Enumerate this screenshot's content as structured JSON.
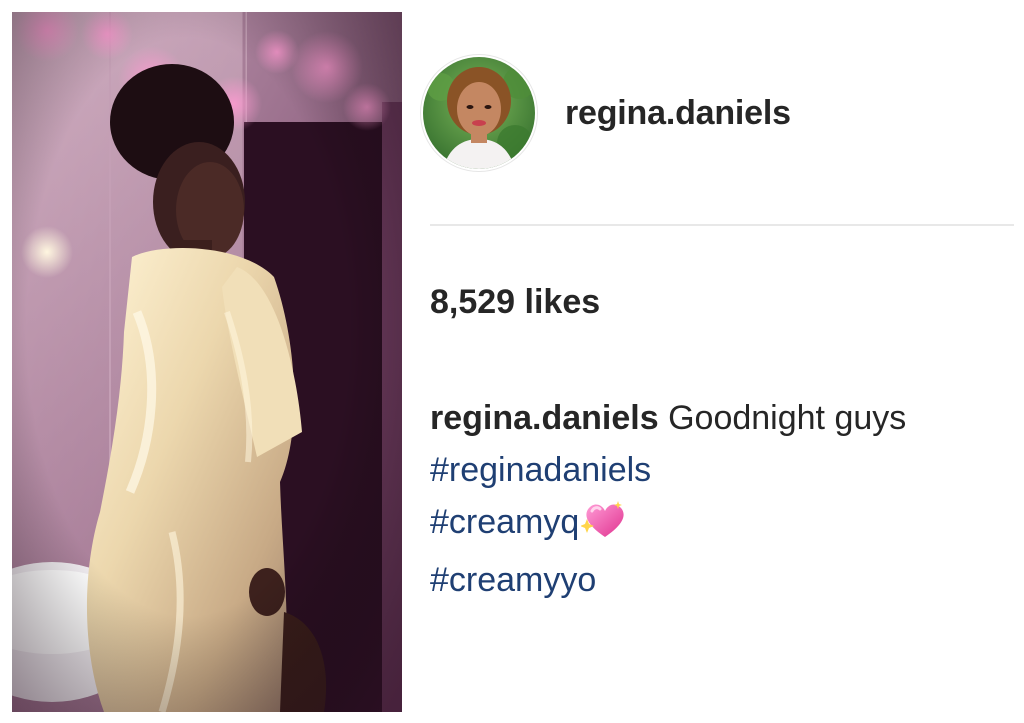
{
  "post": {
    "image_alt": "Photo of a woman in a satin robe",
    "username": "regina.daniels",
    "likes_text": "8,529 likes",
    "caption": {
      "username": "regina.daniels",
      "text": "Goodnight guys",
      "hashtags": [
        "#reginadaniels",
        "#creamyq",
        "#creamyyo"
      ],
      "emoji": "sparkling-heart-icon"
    }
  },
  "colors": {
    "text": "#262626",
    "hashtag": "#1f3f73",
    "divider": "#e8e8e8"
  }
}
